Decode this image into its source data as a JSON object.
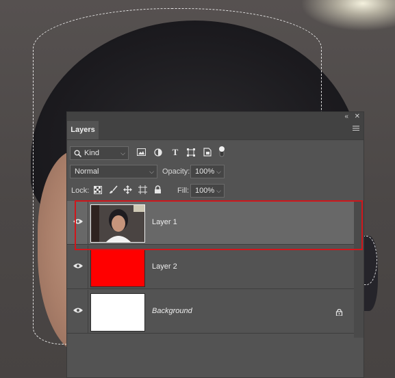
{
  "panel": {
    "collapse_glyph": "«",
    "close_glyph": "✕",
    "tab_label": "Layers",
    "menu_icon": "hamburger-icon"
  },
  "filter": {
    "kind_label": "Kind",
    "icons": [
      "pixel-filter-icon",
      "adjustment-filter-icon",
      "type-filter-icon",
      "shape-filter-icon",
      "smart-object-filter-icon",
      "filter-toggle-icon"
    ],
    "type_glyph": "T"
  },
  "blend": {
    "mode": "Normal",
    "opacity_label": "Opacity:",
    "opacity_value": "100%"
  },
  "lock": {
    "label": "Lock:",
    "icons": [
      "lock-transparent-icon",
      "lock-paint-icon",
      "lock-move-icon",
      "lock-artboard-icon",
      "lock-all-icon"
    ],
    "fill_label": "Fill:",
    "fill_value": "100%"
  },
  "layers": [
    {
      "name": "Layer 1",
      "selected": true,
      "thumb": "photo",
      "visible": true
    },
    {
      "name": "Layer 2",
      "selected": false,
      "thumb": "#ff0000",
      "visible": true
    },
    {
      "name": "Background",
      "selected": false,
      "thumb": "#ffffff",
      "visible": true,
      "locked": true
    }
  ],
  "colors": {
    "panel_bg": "#535353",
    "selected_row": "#686868",
    "highlight_border": "#d0161b"
  }
}
